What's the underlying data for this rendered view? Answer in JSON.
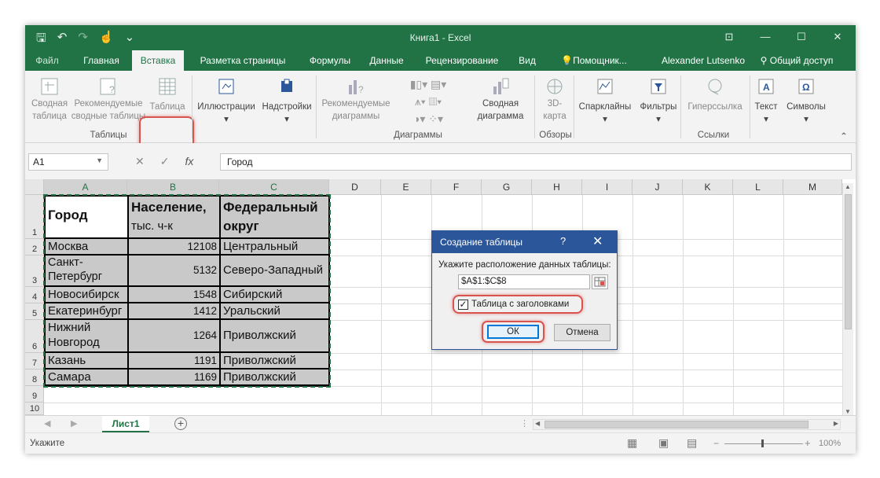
{
  "window": {
    "title": "Книга1 - Excel",
    "user": "Alexander Lutsenko",
    "share_label": "Общий доступ"
  },
  "tabs": [
    {
      "label": "Файл",
      "active": false
    },
    {
      "label": "Главная",
      "active": false
    },
    {
      "label": "Вставка",
      "active": true
    },
    {
      "label": "Разметка страницы",
      "active": false
    },
    {
      "label": "Формулы",
      "active": false
    },
    {
      "label": "Данные",
      "active": false
    },
    {
      "label": "Рецензирование",
      "active": false
    },
    {
      "label": "Вид",
      "active": false
    },
    {
      "label": "Помощник...",
      "active": false
    }
  ],
  "ribbon": {
    "pivot_table": "Сводная таблица",
    "recommended_pivot": "Рекомендуемые сводные таблицы",
    "table": "Таблица",
    "illustrations": "Иллюстрации",
    "addins": "Надстройки",
    "recommended_charts": "Рекомендуемые диаграммы",
    "pivot_chart": "Сводная диаграмма",
    "map_3d": "3D-карта",
    "sparklines": "Спарклайны",
    "filters": "Фильтры",
    "hyperlink": "Гиперссылка",
    "text": "Текст",
    "symbols": "Символы",
    "groups": {
      "tables": "Таблицы",
      "charts": "Диаграммы",
      "tours": "Обзоры",
      "links": "Ссылки"
    }
  },
  "formula_bar": {
    "name_box": "A1",
    "fx": "fx",
    "content": "Город"
  },
  "columns": [
    "A",
    "B",
    "C",
    "D",
    "E",
    "F",
    "G",
    "H",
    "I",
    "J",
    "K",
    "L",
    "M"
  ],
  "rows": [
    "1",
    "2",
    "3",
    "4",
    "5",
    "6",
    "7",
    "8",
    "9",
    "10"
  ],
  "table": {
    "headers": [
      {
        "line1": "Город",
        "line2": ""
      },
      {
        "line1": "Население,",
        "line2": "тыс. ч-к"
      },
      {
        "line1": "Федеральный",
        "line2": "округ"
      }
    ],
    "rows": [
      {
        "city": "Москва",
        "pop": "12108",
        "district": "Центральный"
      },
      {
        "city": "Санкт-\nПетербург",
        "pop": "5132",
        "district": "Северо-Западный"
      },
      {
        "city": "Новосибирск",
        "pop": "1548",
        "district": "Сибирский"
      },
      {
        "city": "Екатеринбург",
        "pop": "1412",
        "district": "Уральский"
      },
      {
        "city": "Нижний\nНовгород",
        "pop": "1264",
        "district": "Приволжский"
      },
      {
        "city": "Казань",
        "pop": "1191",
        "district": "Приволжский"
      },
      {
        "city": "Самара",
        "pop": "1169",
        "district": "Приволжский"
      }
    ]
  },
  "dialog": {
    "title": "Создание таблицы",
    "help": "?",
    "close": "✕",
    "prompt": "Укажите расположение данных таблицы:",
    "range": "$A$1:$C$8",
    "has_headers_label": "Таблица с заголовками",
    "has_headers_checked": true,
    "ok": "ОК",
    "cancel": "Отмена"
  },
  "sheet": {
    "tab": "Лист1",
    "add": "+"
  },
  "status": {
    "text": "Укажите",
    "zoom": "100%"
  },
  "colors": {
    "excel_green": "#217346",
    "selection_gray": "#c9c9c9",
    "dialog_blue": "#2b579a",
    "highlight_red": "#d9534f"
  }
}
